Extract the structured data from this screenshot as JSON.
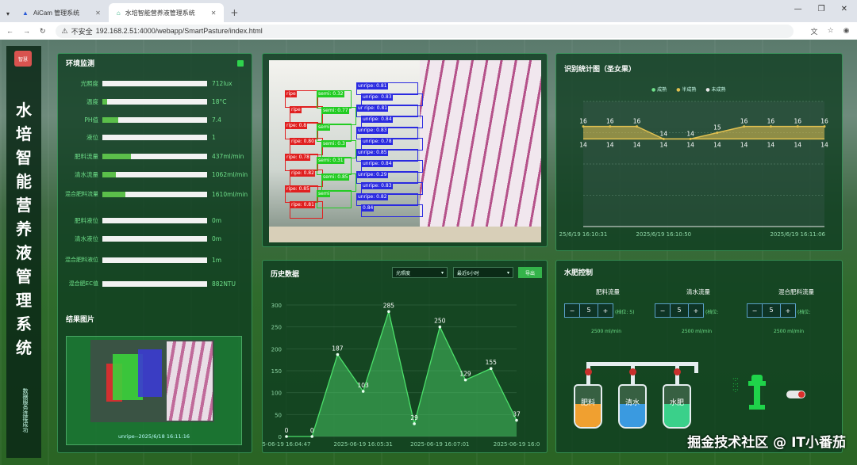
{
  "browser": {
    "tabs": [
      {
        "label": "AiCam 管理系统"
      },
      {
        "label": "水培智能营养液管理系统"
      }
    ],
    "url": "192.168.2.51:4000/webapp/SmartPasture/index.html",
    "security": "不安全"
  },
  "sidebar": {
    "logo": "智慧",
    "title": "水培智能营养液管理系统",
    "status": "数据服务连接成功"
  },
  "env": {
    "title": "环境监测",
    "rows": [
      {
        "label": "光照度",
        "value": "712lux",
        "fill": 1.0
      },
      {
        "label": "温度",
        "value": "18°C",
        "fill": 0.16
      },
      {
        "label": "PH值",
        "value": "7.4",
        "fill": 0.5
      },
      {
        "label": "液位",
        "value": "1",
        "fill": 1.0
      },
      {
        "label": "肥料流量",
        "value": "437ml/min",
        "fill": 0.9
      },
      {
        "label": "清水流量",
        "value": "1062ml/min",
        "fill": 0.42
      },
      {
        "label": "混合肥料流量",
        "value": "1610ml/min",
        "fill": 0.74
      },
      {
        "label": "肥料液位",
        "value": "0m",
        "fill": 0.0
      },
      {
        "label": "清水液位",
        "value": "0m",
        "fill": 0.0
      },
      {
        "label": "混合肥料液位",
        "value": "1m",
        "fill": 1.0
      },
      {
        "label": "混合肥EC值",
        "value": "882NTU",
        "fill": 1.0
      }
    ],
    "fruit_title": "结果图片",
    "fruit_caption": "unripe--2025/6/18 16:11:16"
  },
  "detection": {
    "ripe": [
      "ripe",
      "ripe",
      "ripe: 0.8",
      "ripe: 0.80",
      "ripe: 0.78",
      "ripe: 0.82",
      "ripe: 0.85",
      "ripe: 0.81"
    ],
    "semi": [
      "semi: 0.32",
      "semi: 0.77",
      "semi",
      "semi: 0.3",
      "semi: 0.31",
      "semi: 0.85",
      "semi"
    ],
    "unripe": [
      "unripe: 0.81",
      "unripe: 0.83",
      "ur ripe: 0.81",
      "unripe: 0.84",
      "unripe: 0.83",
      "unripe: 0.78",
      "unripe: 0.85",
      "unripe: 0.84",
      "unripe: 0.29",
      "unripe: 0.83",
      "unripe: 0.82",
      "0.84"
    ]
  },
  "recog": {
    "title": "识别统计图（圣女果）",
    "legend": [
      "成熟",
      "半成熟",
      "未成熟"
    ],
    "colors": [
      "#6fe08a",
      "#e0c050",
      "#e8e8e8"
    ]
  },
  "history": {
    "title": "历史数据",
    "select1": "光照度",
    "select2": "最近6小时",
    "export": "导出"
  },
  "control": {
    "title": "水肥控制",
    "groups": [
      {
        "label": "肥料流量",
        "value": "5",
        "unit": "(档位: 5)",
        "sub": "2500 ml/min"
      },
      {
        "label": "清水流量",
        "value": "5",
        "unit": "(档位:",
        "sub": "2500 ml/min"
      },
      {
        "label": "混合肥料流量",
        "value": "5",
        "unit": "(档位:",
        "sub": "2500 ml/min"
      }
    ],
    "tanks": [
      "肥料",
      "清水",
      "水肥"
    ]
  },
  "watermark": "掘金技术社区 @ IT小番茄",
  "chart_data": [
    {
      "type": "line",
      "title": "识别统计图（圣女果）",
      "x": [
        "25/6/19 16:10:31",
        "",
        "",
        "2025/6/19 16:10:50",
        "",
        "",
        "",
        "",
        "2025/6/19 16:11:06",
        ""
      ],
      "series": [
        {
          "name": "成熟",
          "values": [
            16,
            16,
            16,
            14,
            14,
            15,
            16,
            16,
            16,
            16
          ]
        },
        {
          "name": "半成熟",
          "values": [
            14,
            14,
            14,
            14,
            14,
            14,
            14,
            14,
            14,
            14
          ]
        },
        {
          "name": "未成熟",
          "values": [
            0,
            0,
            0,
            0,
            0,
            0,
            0,
            0,
            0,
            0
          ]
        }
      ],
      "ylim": [
        0,
        20
      ]
    },
    {
      "type": "line",
      "title": "历史数据",
      "x": [
        "5-06-19 16:04:47",
        "",
        "2025-06-19 16:05:31",
        "",
        "",
        "2025-06-19 16:07:01",
        "",
        "2025-06-19 16:0"
      ],
      "values": [
        0,
        0,
        187,
        103,
        285,
        29,
        250,
        129,
        155,
        37
      ],
      "ylim": [
        0,
        300
      ],
      "yticks": [
        0,
        50,
        100,
        150,
        200,
        250,
        300
      ]
    }
  ]
}
